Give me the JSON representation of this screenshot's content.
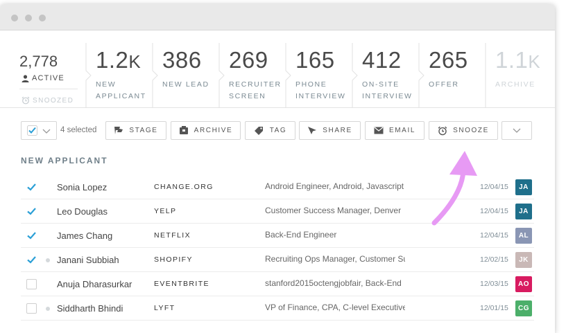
{
  "window": {
    "title": ""
  },
  "summary": {
    "active_count": "2,778",
    "active_label": "ACTIVE",
    "snoozed_label": "SNOOZED"
  },
  "stages": [
    {
      "number": "1.2",
      "unit": "K",
      "label": "NEW\nAPPLICANT",
      "dim": false
    },
    {
      "number": "386",
      "unit": "",
      "label": "NEW LEAD",
      "dim": false
    },
    {
      "number": "269",
      "unit": "",
      "label": "RECRUITER\nSCREEN",
      "dim": false
    },
    {
      "number": "165",
      "unit": "",
      "label": "PHONE\nINTERVIEW",
      "dim": false
    },
    {
      "number": "412",
      "unit": "",
      "label": "ON-SITE\nINTERVIEW",
      "dim": false
    },
    {
      "number": "265",
      "unit": "",
      "label": "OFFER",
      "dim": false
    },
    {
      "number": "1.1",
      "unit": "K",
      "label": "ARCHIVE",
      "dim": true
    }
  ],
  "toolbar": {
    "selected_count": "4 selected",
    "buttons": [
      {
        "label": "STAGE",
        "icon": "flag-icon"
      },
      {
        "label": "ARCHIVE",
        "icon": "archive-box-icon"
      },
      {
        "label": "TAG",
        "icon": "tag-icon"
      },
      {
        "label": "SHARE",
        "icon": "share-cursor-icon"
      },
      {
        "label": "EMAIL",
        "icon": "envelope-icon"
      },
      {
        "label": "SNOOZE",
        "icon": "alarm-clock-icon"
      }
    ]
  },
  "section": {
    "title": "NEW APPLICANT"
  },
  "rows": [
    {
      "checked": true,
      "presence": false,
      "name": "Sonia Lopez",
      "company": "CHANGE.ORG",
      "role": "Android Engineer, Android, Javascript",
      "date": "12/04/15",
      "avatar": "JA",
      "avatar_color": "#1f6f8b"
    },
    {
      "checked": true,
      "presence": false,
      "name": "Leo Douglas",
      "company": "YELP",
      "role": "Customer Success Manager, Denver",
      "date": "12/04/15",
      "avatar": "JA",
      "avatar_color": "#1f6f8b"
    },
    {
      "checked": true,
      "presence": false,
      "name": "James Chang",
      "company": "NETFLIX",
      "role": "Back-End Engineer",
      "date": "12/04/15",
      "avatar": "AL",
      "avatar_color": "#8a96b4"
    },
    {
      "checked": true,
      "presence": true,
      "name": "Janani Subbiah",
      "company": "SHOPIFY",
      "role": "Recruiting Ops Manager, Customer Success",
      "date": "12/02/15",
      "avatar": "JK",
      "avatar_color": "#c9b8b6"
    },
    {
      "checked": false,
      "presence": false,
      "name": "Anuja Dharasurkar",
      "company": "EVENTBRITE",
      "role": "stanford2015octengjobfair, Back-End",
      "date": "12/03/15",
      "avatar": "AO",
      "avatar_color": "#d81b60"
    },
    {
      "checked": false,
      "presence": true,
      "name": "Siddharth Bhindi",
      "company": "LYFT",
      "role": "VP of Finance, CPA, C-level Executive, Finance",
      "date": "12/01/15",
      "avatar": "CG",
      "avatar_color": "#4caf6a"
    }
  ],
  "colors": {
    "accent": "#2a9fd6",
    "arrow": "#e79af4"
  }
}
